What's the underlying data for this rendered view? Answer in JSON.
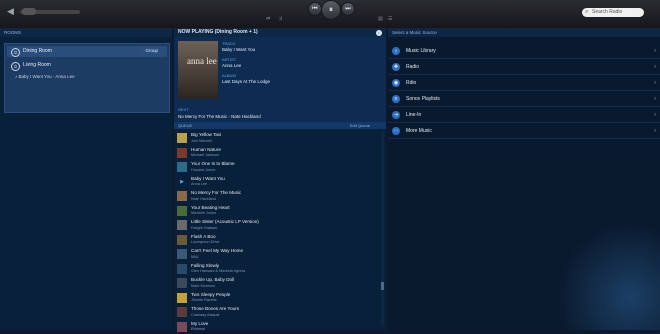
{
  "topbar": {
    "volume_icon": "speaker-icon",
    "transport": {
      "prev_icon": "⏮",
      "play_pause_icon": "⏸",
      "next_icon": "⏭"
    },
    "search_placeholder": "Search Radio",
    "search_icon": "⌕"
  },
  "rooms": {
    "header": "ROOMS",
    "items": [
      {
        "label": "Dining Room",
        "group_label": "Group",
        "icon": "power-icon"
      },
      {
        "label": "Living Room",
        "icon": "power-icon"
      }
    ],
    "track_line": "Baby I Want You - Anna Lee"
  },
  "now_playing": {
    "header": "NOW PLAYING (Dining Room + 1)",
    "art_text": "anna lee",
    "labels": {
      "track": "TRACK",
      "artist": "ARTIST",
      "album": "ALBUM",
      "next": "NEXT"
    },
    "track": "Baby I Want You",
    "artist": "Anna Lee",
    "album": "Last Days At The Lodge",
    "next": "No Mercy For The Music - Nate Hackland"
  },
  "queue": {
    "header": "QUEUE",
    "edit": "Edit Queue",
    "items": [
      {
        "title": "Big Yellow Taxi",
        "artist": "Joni Mitchell"
      },
      {
        "title": "Human Nature",
        "artist": "Michael Jackson"
      },
      {
        "title": "Your One Is to Blame",
        "artist": "Howard Jones"
      },
      {
        "title": "Baby I Want You",
        "artist": "Anna Lee",
        "now": true
      },
      {
        "title": "No Mercy For The Music",
        "artist": "Nate Hackland"
      },
      {
        "title": "Your Beating Heart",
        "artist": "Michelle Jones"
      },
      {
        "title": "Little Sister (Acoustic LP Version)",
        "artist": "Dwight Yoakam"
      },
      {
        "title": "Flash A Boo",
        "artist": "Lovespoon Drive"
      },
      {
        "title": "Can't Feel My Way Home",
        "artist": "MNL"
      },
      {
        "title": "Falling Slowly",
        "artist": "Glen Hansard & Marketa Irglova"
      },
      {
        "title": "Buckle Up, Baby Doll",
        "artist": "Mark Morrison"
      },
      {
        "title": "Two Sleepy People",
        "artist": "Jimmie Ravelle"
      },
      {
        "title": "Those Bones Are Yours",
        "artist": "Crakrasy Alastair"
      },
      {
        "title": "My Love",
        "artist": "Ethereal"
      }
    ]
  },
  "sources": {
    "header": "Select a Music Source",
    "items": [
      {
        "label": "Music Library",
        "icon": "♪"
      },
      {
        "label": "Radio",
        "icon": "✚"
      },
      {
        "label": "Rdio",
        "icon": "◉"
      },
      {
        "label": "Sonos Playlists",
        "icon": "≡"
      },
      {
        "label": "Line-In",
        "icon": "⇥"
      },
      {
        "label": "More Music",
        "icon": "⋯"
      }
    ]
  },
  "colors": {
    "background": "#0b1a2c",
    "accent": "#5fa3e0",
    "panel": "#1d3c63"
  }
}
